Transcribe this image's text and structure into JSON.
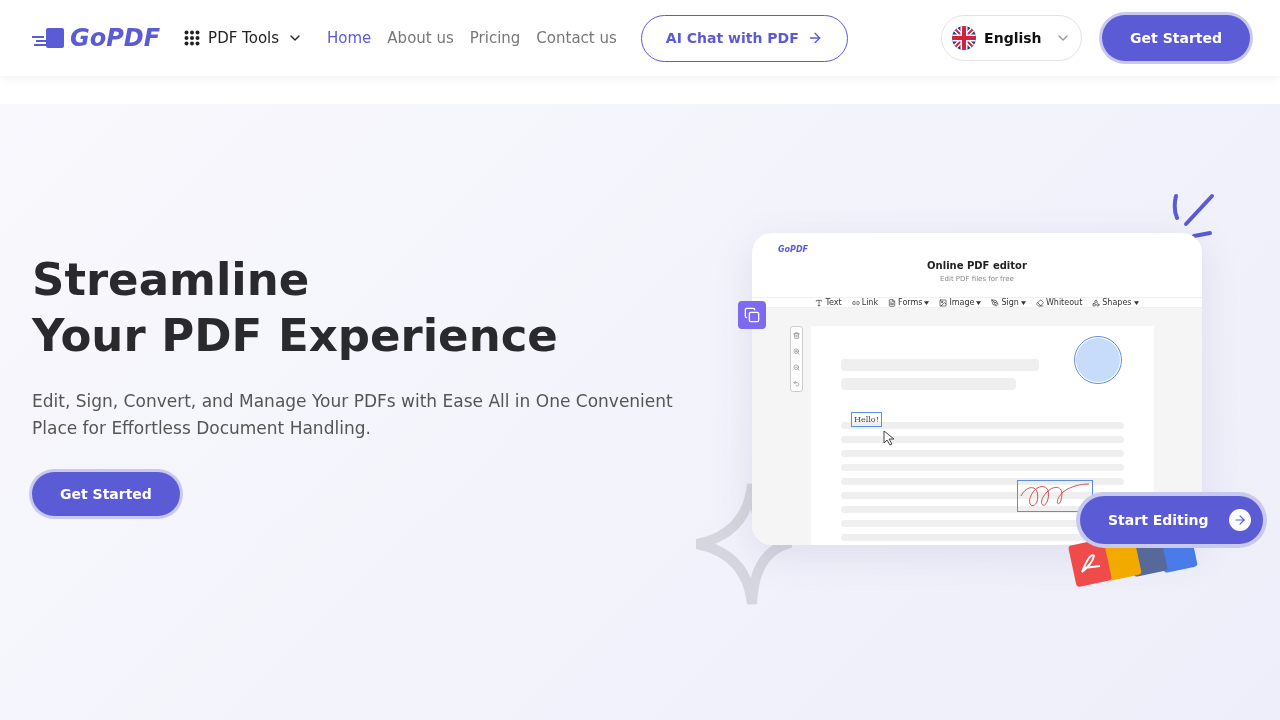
{
  "header": {
    "logo": "GoPDF",
    "tools_menu": "PDF Tools",
    "nav": [
      {
        "label": "Home",
        "selected": true
      },
      {
        "label": "About us",
        "selected": false
      },
      {
        "label": "Pricing",
        "selected": false
      },
      {
        "label": "Contact us",
        "selected": false
      }
    ],
    "ai_button": "AI Chat with PDF",
    "language": "English",
    "cta": "Get Started"
  },
  "hero": {
    "title_lines": [
      "Streamline",
      "Your PDF Experience"
    ],
    "subtitle": "Edit, Sign, Convert, and Manage Your PDFs with Ease All in One Convenient Place for Effortless Document Handling.",
    "cta": "Get Started"
  },
  "editor_preview": {
    "logo": "GoPDF",
    "title": "Online PDF editor",
    "subtitle": "Edit PDF files for free",
    "toolbar": [
      {
        "label": "Text",
        "dropdown": false
      },
      {
        "label": "Link",
        "dropdown": false
      },
      {
        "label": "Forms",
        "dropdown": true
      },
      {
        "label": "Image",
        "dropdown": true
      },
      {
        "label": "Sign",
        "dropdown": true
      },
      {
        "label": "Whiteout",
        "dropdown": false
      },
      {
        "label": "Shapes",
        "dropdown": true
      }
    ],
    "text_box": "Hello!",
    "start_button": "Start Editing"
  }
}
